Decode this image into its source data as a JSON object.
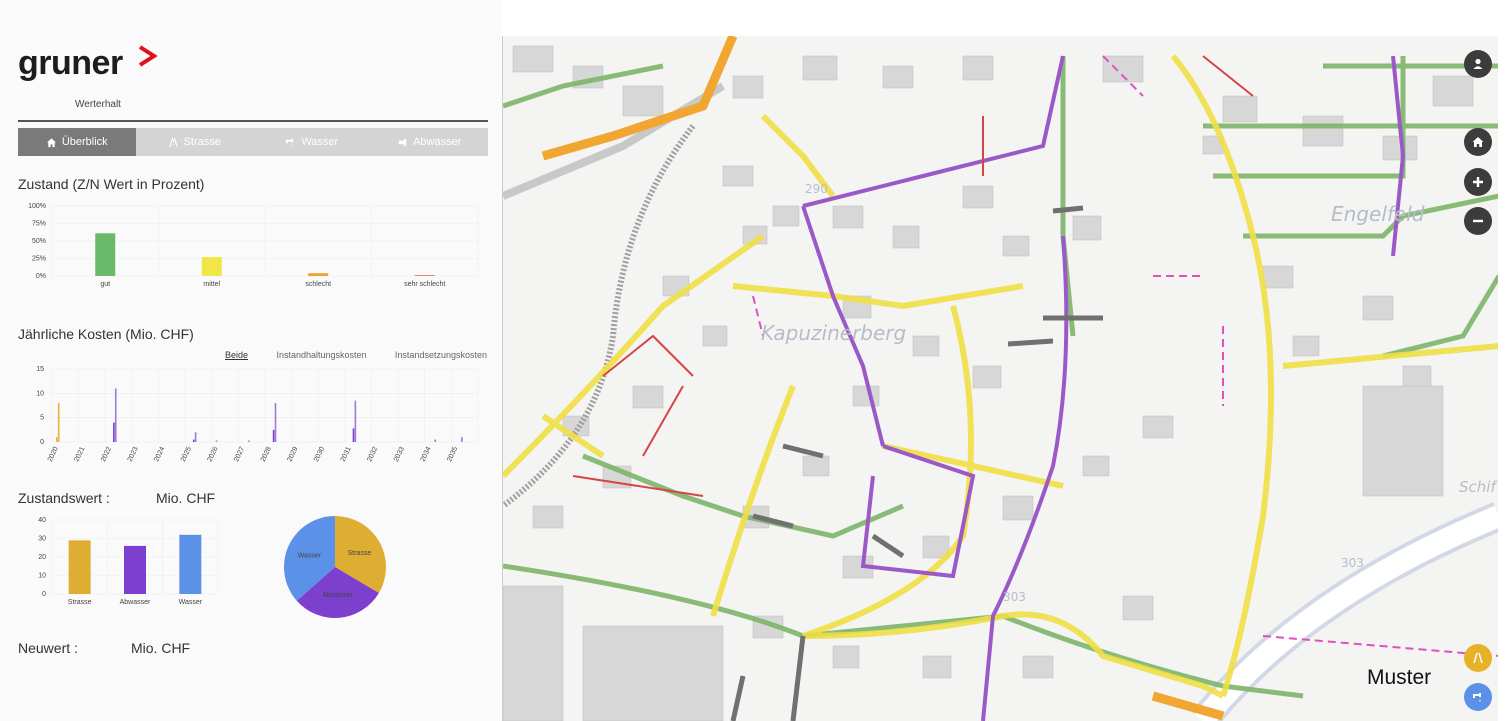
{
  "brand": {
    "name": "gruner",
    "subtitle": "Werterhalt"
  },
  "tabs": [
    {
      "label": "Überblick",
      "icon": "home-icon"
    },
    {
      "label": "Strasse",
      "icon": "road-icon"
    },
    {
      "label": "Wasser",
      "icon": "faucet-icon"
    },
    {
      "label": "Abwasser",
      "icon": "pipe-icon"
    }
  ],
  "zustand": {
    "title": "Zustand (Z/N Wert in Prozent)",
    "chart_data": {
      "type": "bar",
      "categories": [
        "gut",
        "mittel",
        "schlecht",
        "sehr schlecht"
      ],
      "values": [
        61,
        27,
        4,
        1
      ],
      "colors": [
        "#6aba6a",
        "#f0e647",
        "#f0a030",
        "#e05050"
      ],
      "yticks": [
        "0%",
        "25%",
        "50%",
        "75%",
        "100%"
      ],
      "ylim": [
        0,
        100
      ]
    }
  },
  "kosten": {
    "title": "Jährliche Kosten (Mio. CHF)",
    "tabs": [
      "Beide",
      "Instandhaltungskosten",
      "Instandsetzungskosten"
    ],
    "chart_data": {
      "type": "bar",
      "categories": [
        "2020",
        "2021",
        "2022",
        "2023",
        "2024",
        "2025",
        "2026",
        "2027",
        "2028",
        "2029",
        "2030",
        "2031",
        "2032",
        "2033",
        "2034",
        "2035"
      ],
      "series": [
        {
          "color": "#e2b23a",
          "values": [
            1,
            0,
            0,
            0,
            0,
            0,
            0.4,
            0,
            0,
            0,
            0,
            0,
            0,
            0,
            0,
            0
          ]
        },
        {
          "color": "#e2b23a",
          "values": [
            8,
            0,
            0,
            0,
            0,
            0,
            0,
            0,
            0,
            0,
            0,
            0,
            0,
            0,
            0,
            0
          ]
        },
        {
          "color": "#7a3fcf",
          "values": [
            0,
            0,
            4,
            0,
            0,
            0.5,
            0,
            0,
            2.5,
            0,
            0,
            2.8,
            0,
            0,
            0,
            0
          ]
        },
        {
          "color": "#9a7ae0",
          "values": [
            0,
            0,
            11,
            0,
            0,
            2,
            0,
            0.3,
            8,
            0,
            0,
            8.5,
            0,
            0,
            0.5,
            1
          ]
        }
      ],
      "yticks": [
        "0",
        "5",
        "10",
        "15"
      ],
      "ylim": [
        0,
        15
      ]
    }
  },
  "zustandswert": {
    "label": "Zustandswert :",
    "unit": "Mio. CHF",
    "chart_data": {
      "type": "bar",
      "categories": [
        "Strasse",
        "Abwasser",
        "Wasser"
      ],
      "values": [
        29,
        26,
        32
      ],
      "colors": [
        "#deae32",
        "#7d3fce",
        "#5b92e8"
      ],
      "yticks": [
        "0",
        "10",
        "20",
        "30",
        "40"
      ],
      "ylim": [
        0,
        40
      ]
    },
    "pie_data": {
      "type": "pie",
      "slices": [
        {
          "label": "Strasse",
          "value": 33.5,
          "color": "#deae32"
        },
        {
          "label": "Abwasser",
          "value": 30,
          "color": "#7d3fce"
        },
        {
          "label": "Wasser",
          "value": 36.5,
          "color": "#5b92e8"
        }
      ]
    }
  },
  "neuwert": {
    "label": "Neuwert :",
    "unit": "Mio. CHF"
  },
  "map": {
    "labels": [
      "Kapuzinerberg",
      "Engelfeld",
      "Schif",
      "290",
      "303",
      "303"
    ],
    "watermark": "Muster"
  }
}
